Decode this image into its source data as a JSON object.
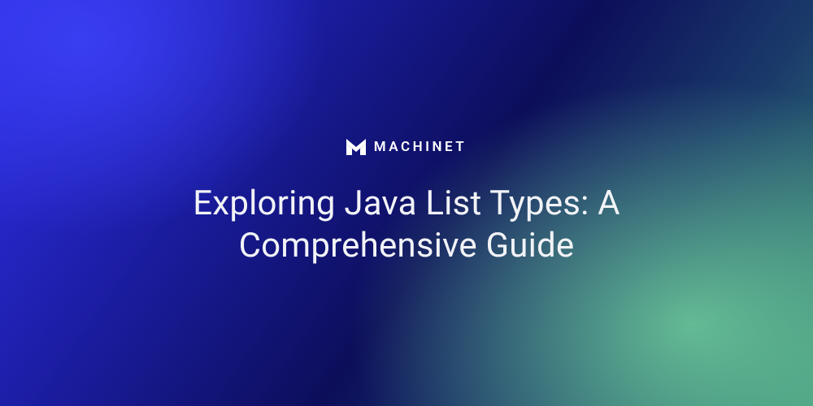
{
  "brand": {
    "name": "MACHINET"
  },
  "title": "Exploring Java List Types: A Comprehensive Guide"
}
